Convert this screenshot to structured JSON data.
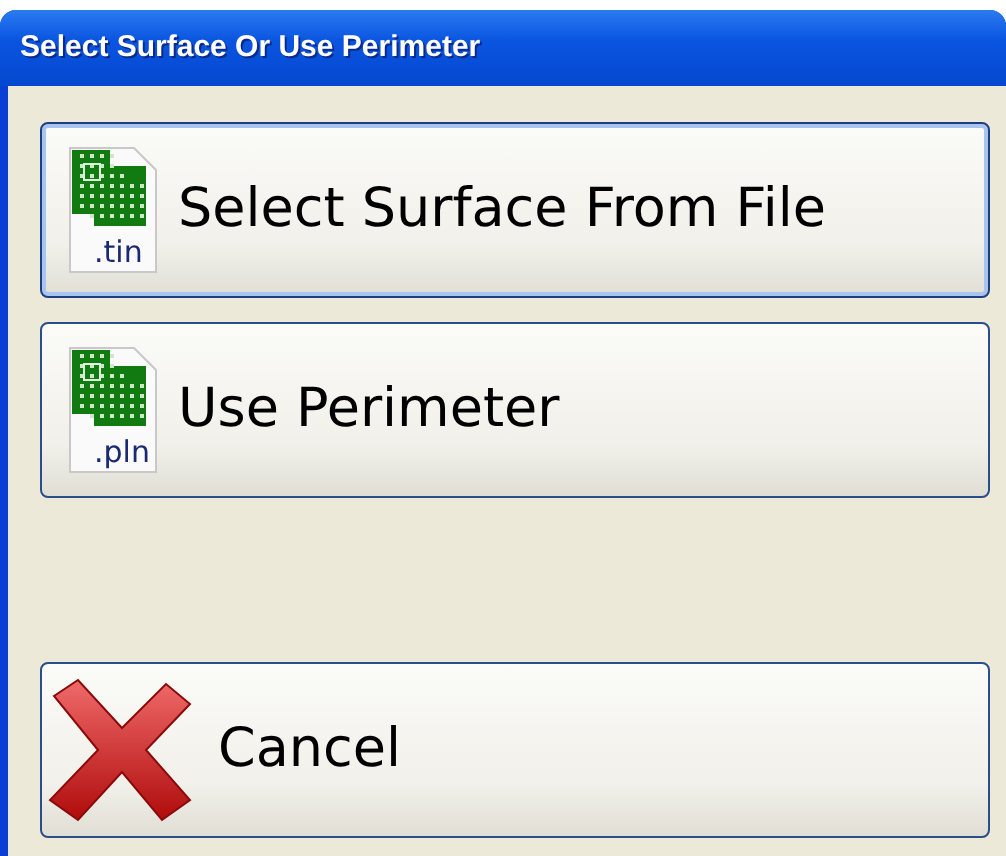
{
  "window": {
    "title": "Select Surface Or Use Perimeter"
  },
  "buttons": [
    {
      "kind": "file",
      "label": "Select Surface From File",
      "extension": ".tin",
      "focused": true
    },
    {
      "kind": "file",
      "label": "Use Perimeter",
      "extension": ".pln",
      "focused": false
    },
    {
      "kind": "spacer"
    },
    {
      "kind": "cancel",
      "label": "Cancel",
      "focused": false
    }
  ]
}
